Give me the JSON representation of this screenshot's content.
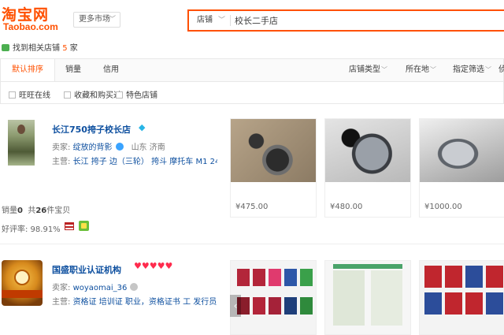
{
  "header": {
    "logo_cn": "淘宝网",
    "logo_en": "Taobao.com",
    "more_market": "更多市场",
    "search_type": "店铺",
    "search_value": "校长二手店"
  },
  "result": {
    "prefix": "找到相关店铺",
    "count": "5",
    "suffix": "家"
  },
  "sort": {
    "default": "默认排序",
    "sales": "销量",
    "credit": "信用",
    "shop_type": "店铺类型",
    "location": "所在地",
    "filter": "指定筛选",
    "cut": "侦"
  },
  "filters": [
    "旺旺在线",
    "收藏和购买过",
    "特色店铺"
  ],
  "shops": [
    {
      "title": "长江750挎子校长店",
      "seller_label": "卖家:",
      "seller": "绽放的背影",
      "location": "山东 济南",
      "main_label": "主营:",
      "main": "长江 挎子 边（三轮） 挎斗 摩托车 M1 24...",
      "sales_label": "销量",
      "sales": "0",
      "total_prefix": "共",
      "total": "26",
      "total_suffix": "件宝贝",
      "rating": "好评率: 98.91%",
      "products": [
        {
          "price": "¥475.00"
        },
        {
          "price": "¥480.00"
        },
        {
          "price": "¥1000.00"
        }
      ]
    },
    {
      "title": "国盛职业认证机构",
      "hearts": "♥♥♥♥♥",
      "seller_label": "卖家:",
      "seller": "woyaomai_36",
      "main_label": "主营:",
      "main": "资格证 培训证 职业，资格证书 工 发行员...",
      "avatar_text": "国盛技术推广"
    }
  ],
  "icons": {
    "diamond": "diamond-icon",
    "wangwang": "wangwang-icon"
  },
  "colors": {
    "brand": "#ff5000",
    "link": "#0d4f9f"
  }
}
